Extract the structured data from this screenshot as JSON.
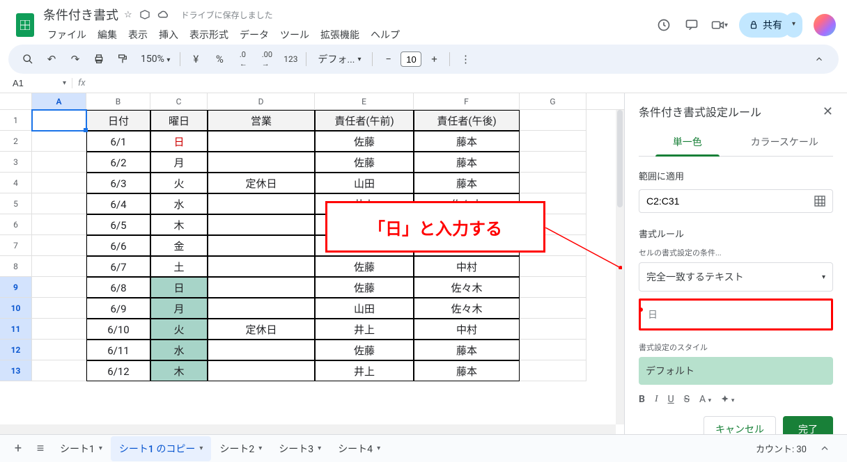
{
  "header": {
    "doc_title": "条件付き書式",
    "saved_text": "ドライブに保存しました",
    "menu": [
      "ファイル",
      "編集",
      "表示",
      "挿入",
      "表示形式",
      "データ",
      "ツール",
      "拡張機能",
      "ヘルプ"
    ],
    "share_label": "共有"
  },
  "toolbar": {
    "zoom": "150%",
    "currency": "¥",
    "percent": "%",
    "dec_dec": ".0",
    "inc_dec": ".00",
    "numfmt": "123",
    "font": "デフォ...",
    "size": "10"
  },
  "fx": {
    "name_box": "A1",
    "formula": "fx"
  },
  "columns": [
    "A",
    "B",
    "C",
    "D",
    "E",
    "F",
    "G"
  ],
  "table": {
    "headers": {
      "b": "日付",
      "c": "曜日",
      "d": "営業",
      "e": "責任者(午前)",
      "f": "責任者(午後)"
    },
    "rows": [
      {
        "n": "1",
        "b": "日付",
        "c": "曜日",
        "d": "営業",
        "e": "責任者(午前)",
        "f": "責任者(午後)",
        "header": true
      },
      {
        "n": "2",
        "b": "6/1",
        "c": "日",
        "d": "",
        "e": "佐藤",
        "f": "藤本",
        "c_red": true
      },
      {
        "n": "3",
        "b": "6/2",
        "c": "月",
        "d": "",
        "e": "佐藤",
        "f": "藤本"
      },
      {
        "n": "4",
        "b": "6/3",
        "c": "火",
        "d": "定休日",
        "e": "山田",
        "f": "藤本"
      },
      {
        "n": "5",
        "b": "6/4",
        "c": "水",
        "d": "",
        "e": "井上",
        "f": "佐々木"
      },
      {
        "n": "6",
        "b": "6/5",
        "c": "木",
        "d": "",
        "e": "",
        "f": ""
      },
      {
        "n": "7",
        "b": "6/6",
        "c": "金",
        "d": "",
        "e": "",
        "f": ""
      },
      {
        "n": "8",
        "b": "6/7",
        "c": "土",
        "d": "",
        "e": "佐藤",
        "f": "中村"
      },
      {
        "n": "9",
        "b": "6/8",
        "c": "日",
        "d": "",
        "e": "佐藤",
        "f": "佐々木",
        "hl": true,
        "sel": true
      },
      {
        "n": "10",
        "b": "6/9",
        "c": "月",
        "d": "",
        "e": "山田",
        "f": "佐々木",
        "hl": true,
        "sel": true
      },
      {
        "n": "11",
        "b": "6/10",
        "c": "火",
        "d": "定休日",
        "e": "井上",
        "f": "中村",
        "hl": true,
        "sel": true
      },
      {
        "n": "12",
        "b": "6/11",
        "c": "水",
        "d": "",
        "e": "佐藤",
        "f": "藤本",
        "hl": true,
        "sel": true
      },
      {
        "n": "13",
        "b": "6/12",
        "c": "木",
        "d": "",
        "e": "井上",
        "f": "藤本",
        "hl": true,
        "sel": true
      }
    ]
  },
  "annotation": {
    "text": "「日」と入力する"
  },
  "sidepanel": {
    "title": "条件付き書式設定ルール",
    "tab1": "単一色",
    "tab2": "カラースケール",
    "range_label": "範囲に適用",
    "range_value": "C2:C31",
    "rule_label": "書式ルール",
    "condition_label": "セルの書式設定の条件...",
    "condition_value": "完全一致するテキスト",
    "value_input": "日",
    "style_label": "書式設定のスタイル",
    "style_default": "デフォルト",
    "cancel": "キャンセル",
    "done": "完了"
  },
  "sheets": {
    "tabs": [
      {
        "label": "シート1",
        "active": false
      },
      {
        "label": "シート1 のコピー",
        "active": true
      },
      {
        "label": "シート2",
        "active": false
      },
      {
        "label": "シート3",
        "active": false
      },
      {
        "label": "シート4",
        "active": false
      }
    ],
    "count": "カウント: 30"
  }
}
